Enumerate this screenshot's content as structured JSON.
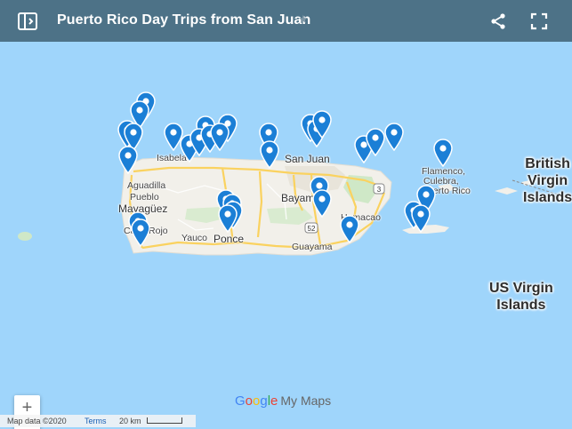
{
  "header": {
    "title": "Puerto Rico Day Trips from San Juan",
    "panel_icon": "side-panel-icon",
    "star_icon": "star-icon",
    "share_icon": "share-icon",
    "fullscreen_icon": "fullscreen-icon"
  },
  "map": {
    "colors": {
      "water": "#9fd5fb",
      "land": "#f2f0ea",
      "park": "#cfe8c7",
      "road": "#fad25f",
      "pin": "#1b7fd6",
      "header": "#4d7287"
    },
    "places": {
      "isabela": "Isabela",
      "aguadilla": "Aguadilla",
      "pueblo": "Pueblo",
      "mayaguez": "Mayagüez",
      "cabo_rojo": "Cabo Rojo",
      "yauco": "Yauco",
      "ponce": "Ponce",
      "san_juan": "San Juan",
      "bayamon": "Bayamón",
      "humacao": "Humacao",
      "guayama": "Guayama",
      "flamenco": "Flamenco,",
      "culebra": "Culebra,",
      "puerto_rico": "Puerto Rico",
      "bvi": "British\nVirgin\nIslands",
      "usvi": "US Virgin\nIslands"
    },
    "road_shields": [
      "3",
      "52"
    ],
    "pin_count": 33
  },
  "controls": {
    "zoom_in": "+",
    "zoom_out": "−"
  },
  "branding": {
    "google": [
      "G",
      "o",
      "o",
      "g",
      "l",
      "e"
    ],
    "product": "My Maps"
  },
  "footer": {
    "map_data": "Map data ©2020",
    "terms": "Terms",
    "scale": "20 km"
  }
}
